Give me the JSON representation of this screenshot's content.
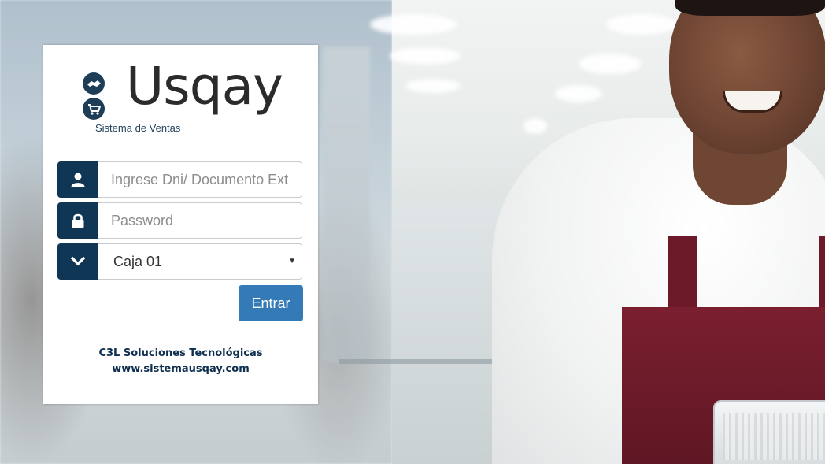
{
  "brand": {
    "name": "Usqay",
    "tagline": "Sistema de Ventas",
    "primary_color": "#0f3654",
    "button_color": "#337ab7"
  },
  "login": {
    "user_field": {
      "icon": "user-icon",
      "placeholder": "Ingrese Dni/ Documento Ext",
      "value": ""
    },
    "password_field": {
      "icon": "lock-icon",
      "placeholder": "Password",
      "value": ""
    },
    "caja_select": {
      "icon": "chevron-down-icon",
      "selected": "Caja 01"
    },
    "submit_label": "Entrar"
  },
  "footer": {
    "company": "C3L Soluciones Tecnológicas",
    "website": "www.sistemausqay.com"
  }
}
